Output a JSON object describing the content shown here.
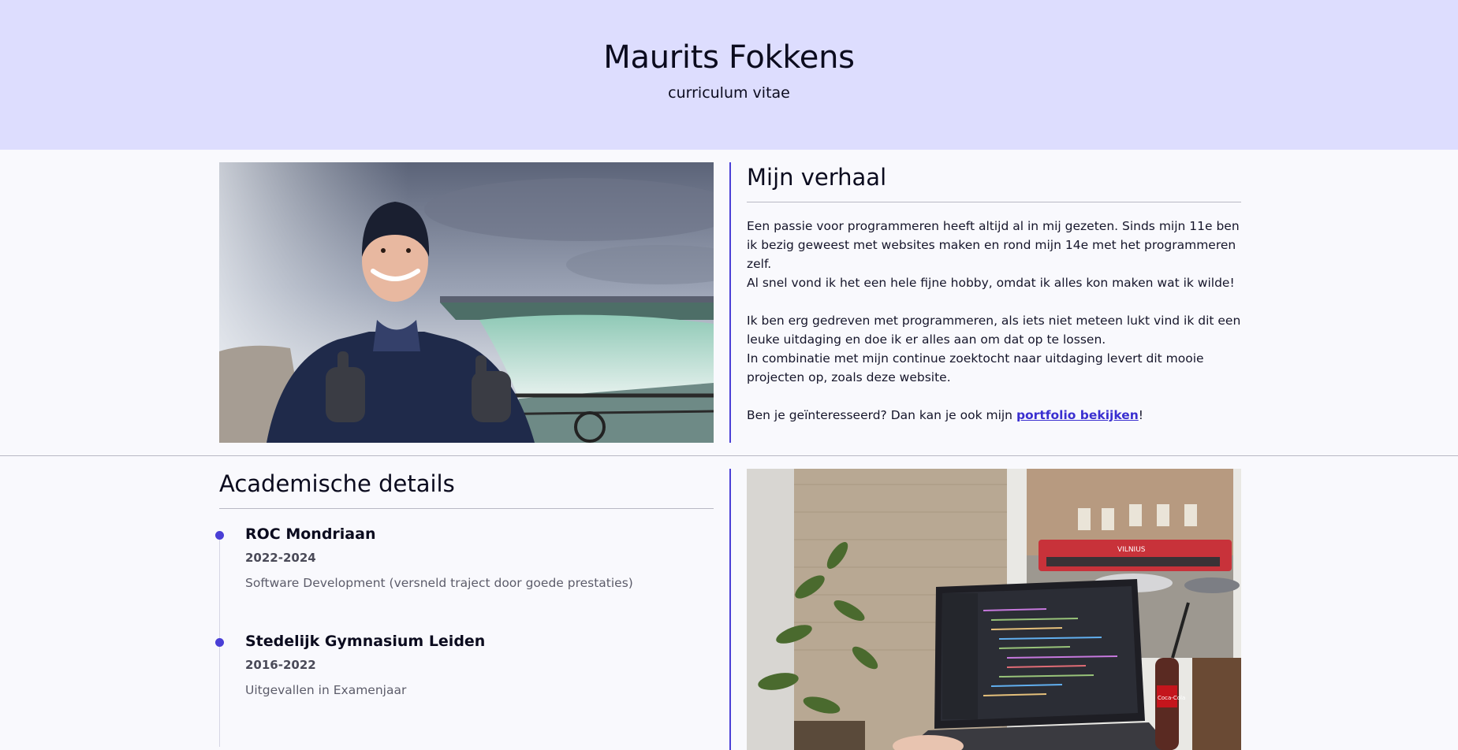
{
  "header": {
    "name": "Maurits Fokkens",
    "subtitle": "curriculum vitae"
  },
  "story": {
    "heading": "Mijn verhaal",
    "p1_line1": "Een passie voor programmeren heeft altijd al in mij gezeten. Sinds mijn 11e ben ik bezig geweest met websites maken en rond mijn 14e met het programmeren zelf.",
    "p1_line2": "Al snel vond ik het een hele fijne hobby, omdat ik alles kon maken wat ik wilde!",
    "p2_line1": "Ik ben erg gedreven met programmeren, als iets niet meteen lukt vind ik dit een leuke uitdaging en doe ik er alles aan om dat op te lossen.",
    "p2_line2": "In combinatie met mijn continue zoektocht naar uitdaging levert dit mooie projecten op, zoals deze website.",
    "p3_text": "Ben je geïnteresseerd? Dan kan je ook mijn ",
    "p3_link": "portfolio bekijken",
    "p3_end": "!"
  },
  "academic": {
    "heading": "Academische details",
    "items": [
      {
        "title": "ROC Mondriaan",
        "years": "2022-2024",
        "desc": "Software Development (versneld traject door goede prestaties)"
      },
      {
        "title": "Stedelijk Gymnasium Leiden",
        "years": "2016-2022",
        "desc": "Uitgevallen in Examenjaar"
      }
    ]
  },
  "photo_laptop": {
    "bus_sign": "VILNIUS",
    "bottle_label": "Coca-Cola"
  },
  "colors": {
    "header_bg": "#ddddfe",
    "accent": "#4a3fd6",
    "page_bg": "#f9f9fd"
  }
}
